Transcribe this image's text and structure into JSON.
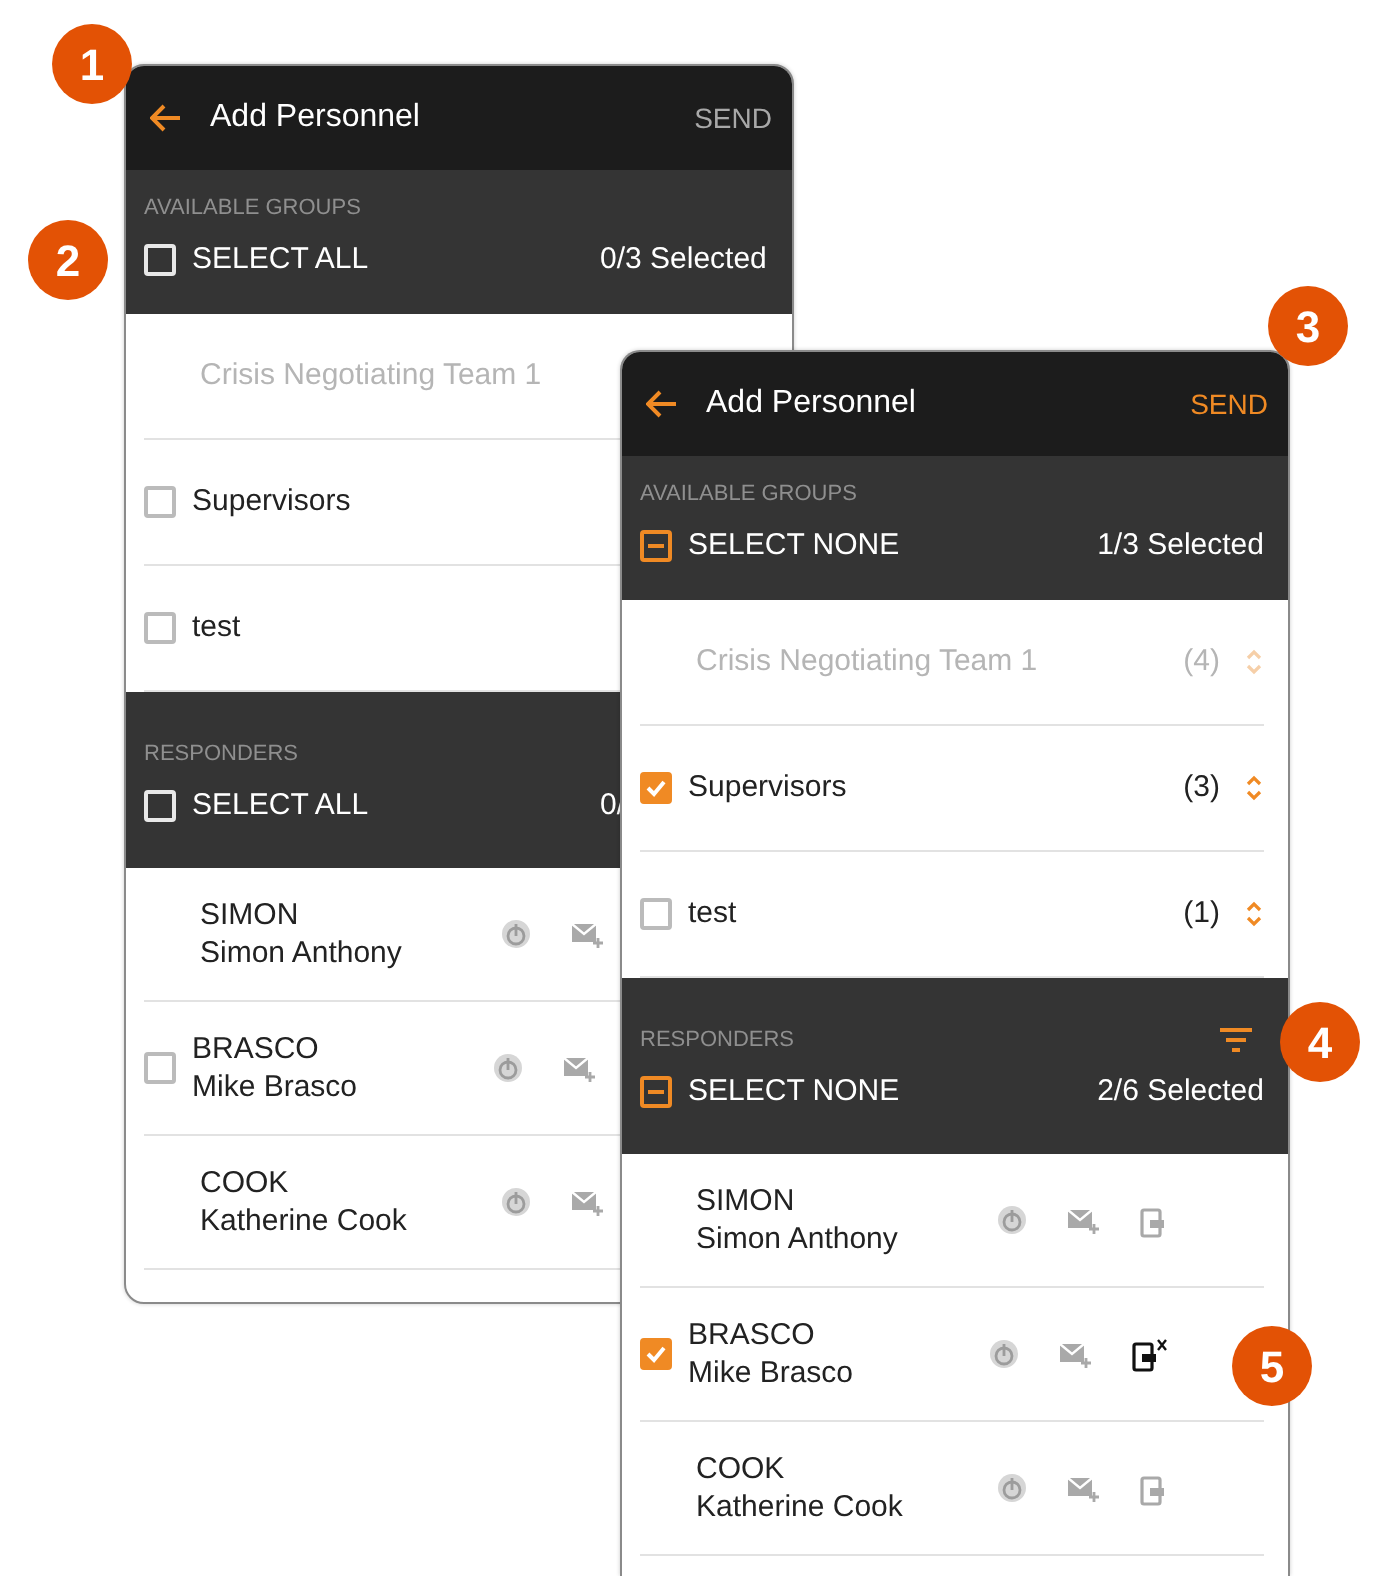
{
  "callouts": [
    "1",
    "2",
    "3",
    "4",
    "5"
  ],
  "screens": [
    {
      "title": "Add Personnel",
      "send": {
        "label": "SEND",
        "enabled": false
      },
      "groups": {
        "heading": "AVAILABLE GROUPS",
        "select": {
          "label": "SELECT ALL",
          "partial": false
        },
        "count": "0/3 Selected",
        "items": [
          {
            "name": "Crisis Negotiating Team 1",
            "selectable": false
          },
          {
            "name": "Supervisors",
            "selectable": true,
            "checked": false
          },
          {
            "name": "test",
            "selectable": true,
            "checked": false
          }
        ]
      },
      "responders": {
        "heading": "RESPONDERS",
        "select": {
          "label": "SELECT ALL",
          "partial": false
        },
        "count": "0/",
        "items": [
          {
            "callsign": "SIMON",
            "name": "Simon Anthony"
          },
          {
            "callsign": "BRASCO",
            "name": "Mike Brasco",
            "checked": false
          },
          {
            "callsign": "COOK",
            "name": "Katherine Cook"
          }
        ]
      }
    },
    {
      "title": "Add Personnel",
      "send": {
        "label": "SEND",
        "enabled": true
      },
      "groups": {
        "heading": "AVAILABLE GROUPS",
        "select": {
          "label": "SELECT NONE",
          "partial": true
        },
        "count": "1/3 Selected",
        "items": [
          {
            "name": "Crisis Negotiating Team 1",
            "selectable": false,
            "count": "(4)"
          },
          {
            "name": "Supervisors",
            "selectable": true,
            "checked": true,
            "count": "(3)"
          },
          {
            "name": "test",
            "selectable": true,
            "checked": false,
            "count": "(1)"
          }
        ]
      },
      "responders": {
        "heading": "RESPONDERS",
        "filter": true,
        "select": {
          "label": "SELECT NONE",
          "partial": true
        },
        "count": "2/6 Selected",
        "items": [
          {
            "callsign": "SIMON",
            "name": "Simon Anthony",
            "device_active": false
          },
          {
            "callsign": "BRASCO",
            "name": "Mike Brasco",
            "checked": true,
            "device_active": true
          },
          {
            "callsign": "COOK",
            "name": "Katherine Cook",
            "device_active": false
          }
        ]
      }
    }
  ]
}
